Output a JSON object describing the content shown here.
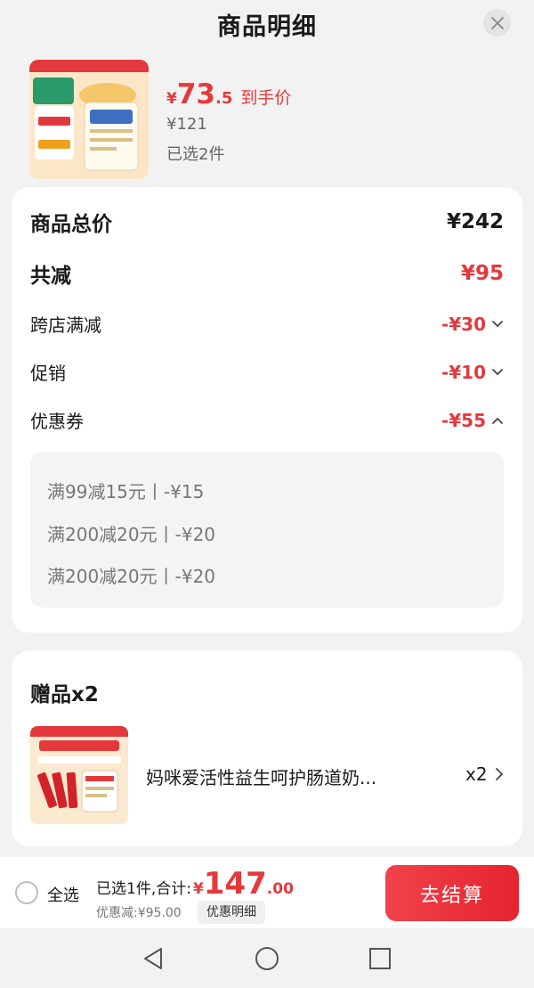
{
  "header": {
    "title": "商品明细"
  },
  "product": {
    "price_symbol": "¥",
    "price_int": "73",
    "price_dec": ".5",
    "price_tag": "到手价",
    "original_price": "¥121",
    "selected_count": "已选2件"
  },
  "breakdown": {
    "total_label": "商品总价",
    "total_value": "¥242",
    "reduce_label": "共减",
    "reduce_value": "¥95",
    "items": [
      {
        "label": "跨店满减",
        "value": "-¥30",
        "expanded": false
      },
      {
        "label": "促销",
        "value": "-¥10",
        "expanded": false
      },
      {
        "label": "优惠券",
        "value": "-¥55",
        "expanded": true
      }
    ],
    "coupons": [
      "满99减15元丨-¥15",
      "满200减20元丨-¥20",
      "满200减20元丨-¥20"
    ]
  },
  "gift": {
    "title": "赠品x2",
    "name": "妈咪爱活性益生呵护肠道奶...",
    "qty": "x2"
  },
  "bottom_bar": {
    "select_all": "全选",
    "total_label": "已选1件,合计:",
    "total_yen": "¥",
    "total_int": "147",
    "total_dec": ".00",
    "discount_text": "优惠减:¥95.00",
    "detail_label": "优惠明细",
    "checkout_label": "去结算"
  },
  "colors": {
    "accent_red": "#e4393c",
    "background": "#f2f2f2",
    "card": "#ffffff"
  },
  "icons": [
    "close-icon",
    "chevron-down-icon",
    "chevron-up-icon",
    "chevron-right-icon",
    "nav-back-icon",
    "nav-home-icon",
    "nav-recents-icon"
  ]
}
